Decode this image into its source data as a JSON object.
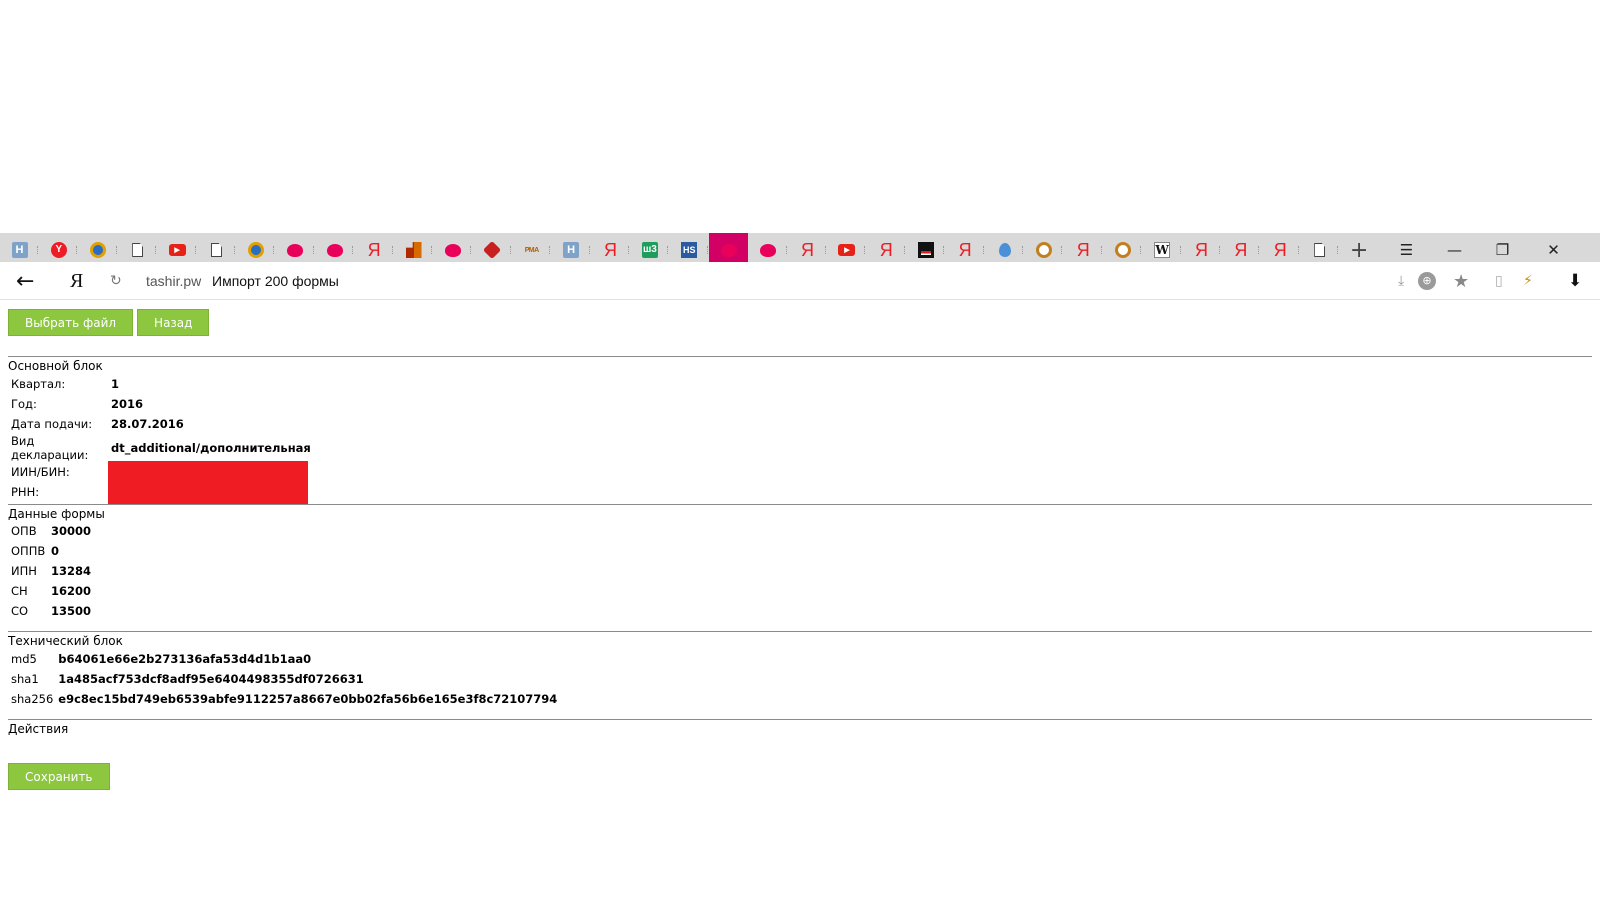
{
  "tabs": [
    {
      "icon": "letter-icon",
      "glyph": "H",
      "style": "letter"
    },
    {
      "icon": "yandex-browser-icon",
      "glyph": "Y",
      "style": "yabrowser"
    },
    {
      "icon": "mail-icon",
      "glyph": "",
      "style": "mail"
    },
    {
      "icon": "document-icon",
      "glyph": "",
      "style": "doc"
    },
    {
      "icon": "youtube-icon",
      "glyph": "▶",
      "style": "youtube"
    },
    {
      "icon": "document-icon",
      "glyph": "",
      "style": "doc"
    },
    {
      "icon": "mail-icon",
      "glyph": "",
      "style": "mail"
    },
    {
      "icon": "speech-bubble-icon",
      "glyph": "",
      "style": "bubble"
    },
    {
      "icon": "speech-bubble-icon",
      "glyph": "",
      "style": "bubble"
    },
    {
      "icon": "yandex-icon",
      "glyph": "Я",
      "style": "yandex"
    },
    {
      "icon": "blocks-icon",
      "glyph": "",
      "style": "blocks"
    },
    {
      "icon": "speech-bubble-icon",
      "glyph": "",
      "style": "bubble"
    },
    {
      "icon": "cube-icon",
      "glyph": "",
      "style": "cube"
    },
    {
      "icon": "rma-icon",
      "glyph": "РМА",
      "style": "rma"
    },
    {
      "icon": "letter-icon",
      "glyph": "H",
      "style": "letter"
    },
    {
      "icon": "yandex-icon",
      "glyph": "Я",
      "style": "yandex"
    },
    {
      "icon": "green-site-icon",
      "glyph": "ш3",
      "style": "green"
    },
    {
      "icon": "hs-icon",
      "glyph": "HS",
      "style": "hs"
    },
    {
      "icon": "speech-bubble-icon",
      "glyph": "",
      "style": "bubble",
      "active": true
    },
    {
      "icon": "speech-bubble-icon",
      "glyph": "",
      "style": "bubble"
    },
    {
      "icon": "yandex-icon",
      "glyph": "Я",
      "style": "yandex"
    },
    {
      "icon": "youtube-icon",
      "glyph": "▶",
      "style": "youtube"
    },
    {
      "icon": "yandex-icon",
      "glyph": "Я",
      "style": "yandex"
    },
    {
      "icon": "flag-icon",
      "glyph": "",
      "style": "flag"
    },
    {
      "icon": "yandex-icon",
      "glyph": "Я",
      "style": "yandex"
    },
    {
      "icon": "drop-icon",
      "glyph": "",
      "style": "drop"
    },
    {
      "icon": "gear-icon",
      "glyph": "",
      "style": "gear"
    },
    {
      "icon": "yandex-icon",
      "glyph": "Я",
      "style": "yandex"
    },
    {
      "icon": "gear-icon",
      "glyph": "",
      "style": "gear"
    },
    {
      "icon": "wikipedia-icon",
      "glyph": "W",
      "style": "wiki"
    },
    {
      "icon": "yandex-icon",
      "glyph": "Я",
      "style": "yandex"
    },
    {
      "icon": "yandex-icon",
      "glyph": "Я",
      "style": "yandex"
    },
    {
      "icon": "yandex-icon",
      "glyph": "Я",
      "style": "yandex"
    },
    {
      "icon": "document-icon",
      "glyph": "",
      "style": "doc"
    }
  ],
  "window_controls": {
    "menu": "☰",
    "minimize": "—",
    "restore": "❐",
    "close": "✕",
    "new_tab": "+"
  },
  "addressbar": {
    "back": "←",
    "logo": "Я",
    "reload": "↻",
    "host": "tashir.pw",
    "title": "Импорт 200 формы",
    "download_small": "⤓",
    "protect": "⊕",
    "star": "★",
    "ext1": "▯",
    "ext2": "⚡",
    "download": "⬇"
  },
  "buttons": {
    "choose_file": "Выбрать файл",
    "back": "Назад",
    "save": "Сохранить"
  },
  "main_block": {
    "legend": "Основной блок",
    "rows": [
      {
        "label": "Квартал:",
        "value": "1"
      },
      {
        "label": "Год:",
        "value": "2016"
      },
      {
        "label": "Дата подачи:",
        "value": "28.07.2016"
      },
      {
        "label": "Вид декларации:",
        "value": "dt_additional/дополнительная"
      },
      {
        "label": "ИИН/БИН:",
        "value": ""
      },
      {
        "label": "РНН:",
        "value": ""
      }
    ]
  },
  "form_data": {
    "legend": "Данные формы",
    "rows": [
      {
        "label": "ОПВ",
        "value": "30000"
      },
      {
        "label": "ОППВ",
        "value": "0"
      },
      {
        "label": "ИПН",
        "value": "13284"
      },
      {
        "label": "СН",
        "value": "16200"
      },
      {
        "label": "СО",
        "value": "13500"
      }
    ]
  },
  "tech_block": {
    "legend": "Технический блок",
    "rows": [
      {
        "label": "md5",
        "value": "b64061e66e2b273136afa53d4d1b1aa0"
      },
      {
        "label": "sha1",
        "value": "1a485acf753dcf8adf95e6404498355df0726631"
      },
      {
        "label": "sha256",
        "value": "e9c8ec15bd749eb6539abfe9112257a8667e0bb02fa56b6e165e3f8c72107794"
      }
    ]
  },
  "actions": {
    "legend": "Действия"
  }
}
